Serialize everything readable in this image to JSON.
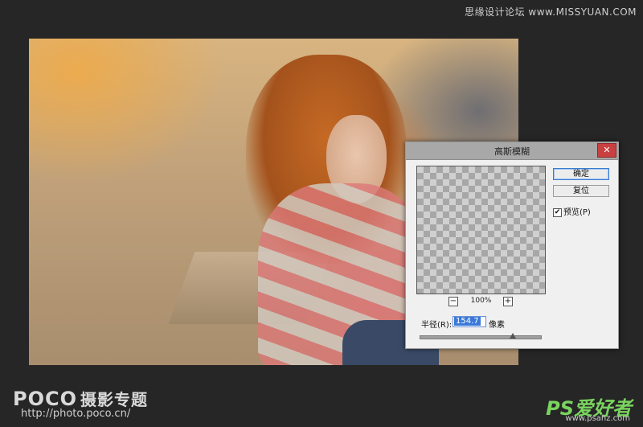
{
  "watermark_top": "思缘设计论坛 www.MISSYUAN.COM",
  "dialog": {
    "title": "高斯模糊",
    "close_glyph": "✕",
    "ok_label": "确定",
    "reset_label": "复位",
    "preview_label": "预览(P)",
    "preview_checked": true,
    "zoom_out_glyph": "−",
    "zoom_in_glyph": "+",
    "zoom_level": "100%",
    "radius_label": "半径(R):",
    "radius_value": "154.7",
    "radius_unit": "像素",
    "radius_slider_fraction": 0.77
  },
  "logos": {
    "poco_brand": "POCO",
    "poco_sub": "摄影专题",
    "poco_url": "http://photo.poco.cn/",
    "ps_brand": "PS爱好者",
    "ps_url": "www.psahz.com"
  },
  "colors": {
    "background": "#262626",
    "close_button": "#c94040",
    "selection": "#3a79d8",
    "ps_logo": "#7ad35f"
  }
}
